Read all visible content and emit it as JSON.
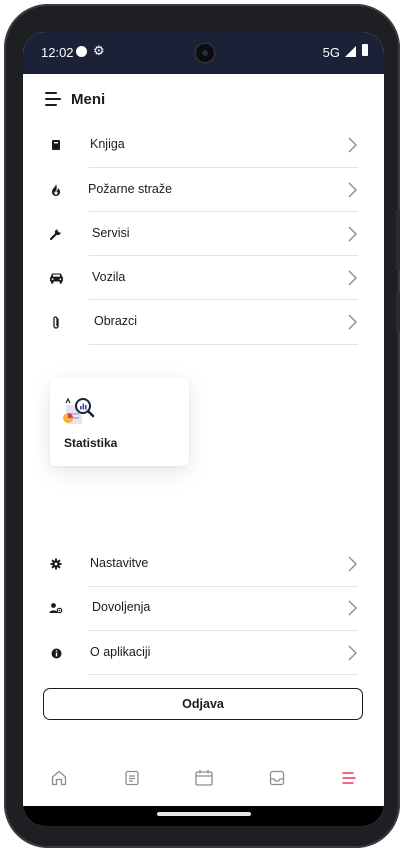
{
  "status_bar": {
    "time": "12:02",
    "network": "5G"
  },
  "header": {
    "title": "Meni"
  },
  "menu_top": [
    {
      "label": "Knjiga",
      "icon": "book-icon"
    },
    {
      "label": "Požarne straže",
      "icon": "fire-icon"
    },
    {
      "label": "Servisi",
      "icon": "wrench-icon"
    },
    {
      "label": "Vozila",
      "icon": "car-icon"
    },
    {
      "label": "Obrazci",
      "icon": "paperclip-icon"
    }
  ],
  "feature_card": {
    "label": "Statistika",
    "icon": "statistics-icon"
  },
  "menu_bottom": [
    {
      "label": "Nastavitve",
      "icon": "settings-icon"
    },
    {
      "label": "Dovoljenja",
      "icon": "user-permissions-icon"
    },
    {
      "label": "O aplikaciji",
      "icon": "info-icon"
    }
  ],
  "logout_label": "Odjava",
  "bottom_nav": {
    "items": [
      "home-icon",
      "document-icon",
      "calendar-icon",
      "inbox-icon",
      "menu-icon"
    ],
    "active": "menu-icon",
    "active_color": "#e8335a",
    "inactive_color": "#8a8d93"
  },
  "colors": {
    "status_bar": "#1b2238",
    "text": "#1b1b1f",
    "divider": "#e4e4e7"
  }
}
